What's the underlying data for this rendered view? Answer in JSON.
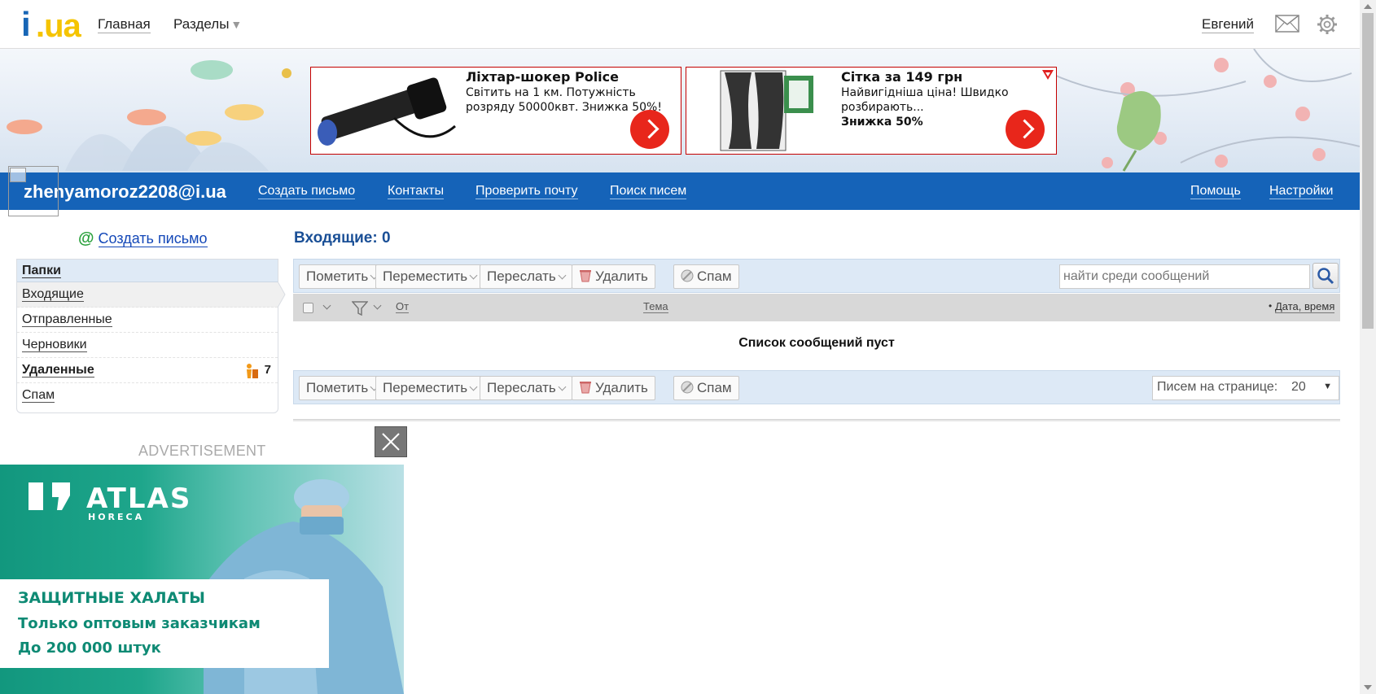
{
  "topbar": {
    "logo_i": "i",
    "logo_ua": ".ua",
    "home": "Главная",
    "sections": "Разделы",
    "user": "Евгений",
    "mail_icon": "envelope-icon",
    "settings_icon": "gear-icon"
  },
  "ads": [
    {
      "title": "Ліхтар-шокер Police",
      "text": "Світить на 1 км. Потужність розряду 50000квт. Знижка 50%!",
      "bold": ""
    },
    {
      "title": "Сітка за 149 грн",
      "text": "Найвигідніша ціна! Швидко розбирають...",
      "bold": "Знижка 50%"
    }
  ],
  "nav": {
    "account": "zhenyamoroz2208@i.ua",
    "compose": "Создать письмо",
    "contacts": "Контакты",
    "check": "Проверить почту",
    "search": "Поиск писем",
    "help": "Помощь",
    "settings": "Настройки"
  },
  "sidebar": {
    "compose": "Создать письмо",
    "folders_title": "Папки",
    "items": [
      {
        "label": "Входящие",
        "count": ""
      },
      {
        "label": "Отправленные",
        "count": ""
      },
      {
        "label": "Черновики",
        "count": ""
      },
      {
        "label": "Удаленные",
        "count": "7"
      },
      {
        "label": "Спам",
        "count": ""
      }
    ]
  },
  "main": {
    "title": "Входящие: 0",
    "toolbar": {
      "mark": "Пометить",
      "move": "Переместить",
      "forward": "Переслать",
      "delete": "Удалить",
      "spam": "Спам",
      "search_placeholder": "найти среди сообщений",
      "per_page_label": "Писем на странице:",
      "per_page_value": "20"
    },
    "columns": {
      "from": "От",
      "subject": "Тема",
      "date": "Дата, время"
    },
    "empty": "Список сообщений пуст"
  },
  "bottom_ad": {
    "label": "ADVERTISEMENT",
    "brand": "ATLAS",
    "brand_sub": "HORECA",
    "line1": "ЗАЩИТНЫЕ ХАЛАТЫ",
    "line2": "Только оптовым заказчикам",
    "line3": "До 200 000 штук"
  },
  "colors": {
    "brand_blue": "#1563b8",
    "logo_yellow": "#f5c400",
    "ad_red": "#e8261b",
    "teal": "#12977e"
  }
}
